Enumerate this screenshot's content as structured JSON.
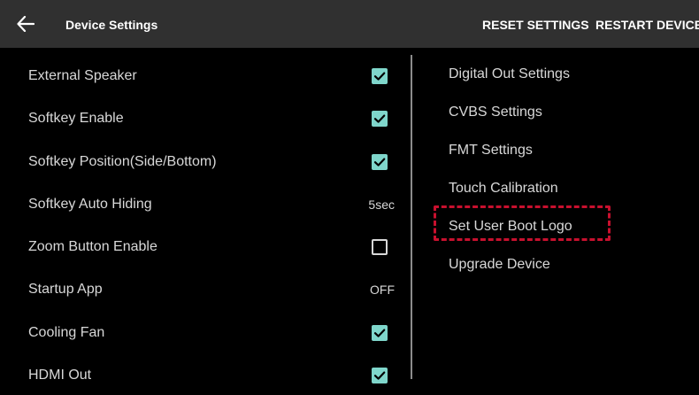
{
  "app_bar": {
    "back_icon": "arrow-left-icon",
    "title": "Device Settings",
    "actions": [
      "RESET SETTINGS",
      "RESTART DEVICE"
    ]
  },
  "left_settings": [
    {
      "label": "External Speaker",
      "control": "checkbox",
      "checked": true
    },
    {
      "label": "Softkey Enable",
      "control": "checkbox",
      "checked": true
    },
    {
      "label": "Softkey Position(Side/Bottom)",
      "control": "checkbox",
      "checked": true
    },
    {
      "label": "Softkey Auto Hiding",
      "control": "value",
      "value": "5sec"
    },
    {
      "label": "Zoom Button Enable",
      "control": "checkbox",
      "checked": false
    },
    {
      "label": "Startup App",
      "control": "value",
      "value": "OFF"
    },
    {
      "label": "Cooling Fan",
      "control": "checkbox",
      "checked": true
    },
    {
      "label": "HDMI Out",
      "control": "checkbox",
      "checked": true
    }
  ],
  "right_menu": [
    {
      "label": "Digital Out Settings"
    },
    {
      "label": "CVBS Settings"
    },
    {
      "label": "FMT Settings"
    },
    {
      "label": "Touch Calibration"
    },
    {
      "label": "Set User Boot Logo",
      "highlighted": true
    },
    {
      "label": "Upgrade Device"
    }
  ],
  "colors": {
    "app_bar_bg": "#303030",
    "background": "#000000",
    "checkbox_checked": "#7fd6cb",
    "highlight_dash": "#c8102e"
  }
}
